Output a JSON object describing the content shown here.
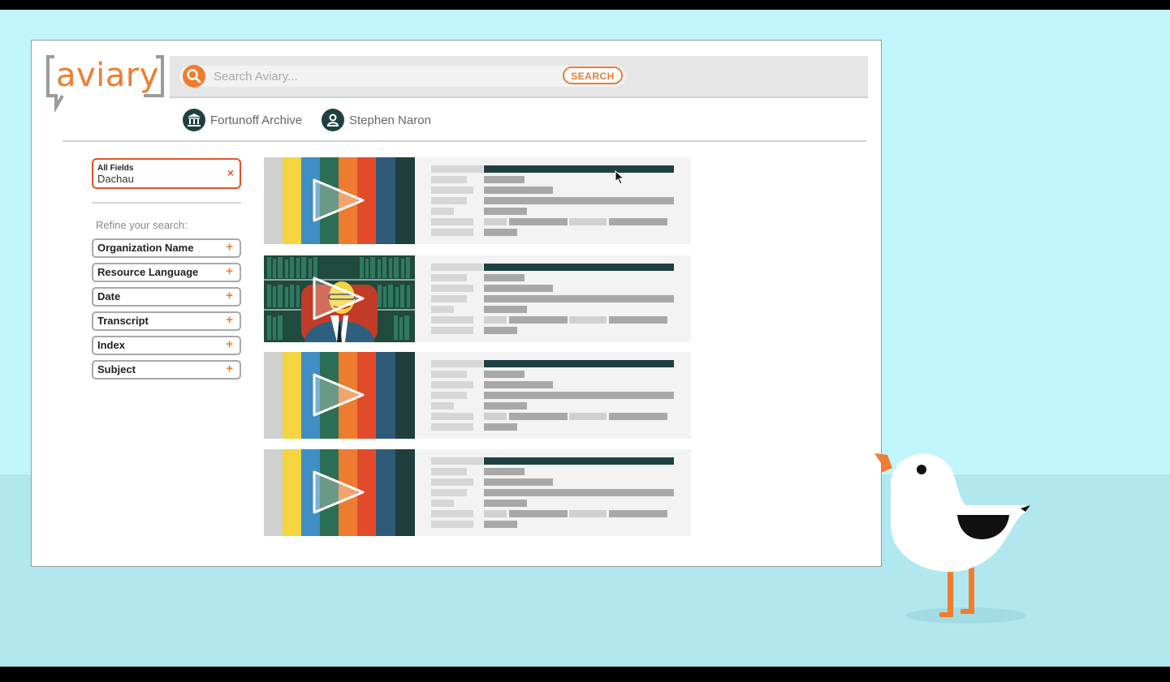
{
  "app": {
    "logo_text": "aviary"
  },
  "search": {
    "placeholder": "Search Aviary...",
    "button_label": "SEARCH"
  },
  "breadcrumbs": [
    {
      "label": "Fortunoff Archive",
      "icon": "building-columns-icon"
    },
    {
      "label": "Stephen Naron",
      "icon": "user-icon"
    }
  ],
  "active_filter": {
    "field": "All Fields",
    "value": "Dachau",
    "remove_icon": "close-icon"
  },
  "sidebar": {
    "refine_label": "Refine your search:",
    "facets": [
      {
        "label": "Organization Name"
      },
      {
        "label": "Resource Language"
      },
      {
        "label": "Date"
      },
      {
        "label": "Transcript"
      },
      {
        "label": "Index"
      },
      {
        "label": "Subject"
      }
    ]
  },
  "results": [
    {
      "thumbnail": "color-bars"
    },
    {
      "thumbnail": "interview-portrait"
    },
    {
      "thumbnail": "color-bars"
    },
    {
      "thumbnail": "color-bars"
    }
  ],
  "colors": {
    "accent": "#f07c2f",
    "filter_border": "#e2512d",
    "dark_teal": "#1f4040",
    "background": "#c0f6fb",
    "color_bars": [
      "#d0d0d0",
      "#f4d53f",
      "#3f8ec4",
      "#2b6e54",
      "#ee7c30",
      "#e24a2c",
      "#2f5a77",
      "#1f3f3c"
    ]
  }
}
